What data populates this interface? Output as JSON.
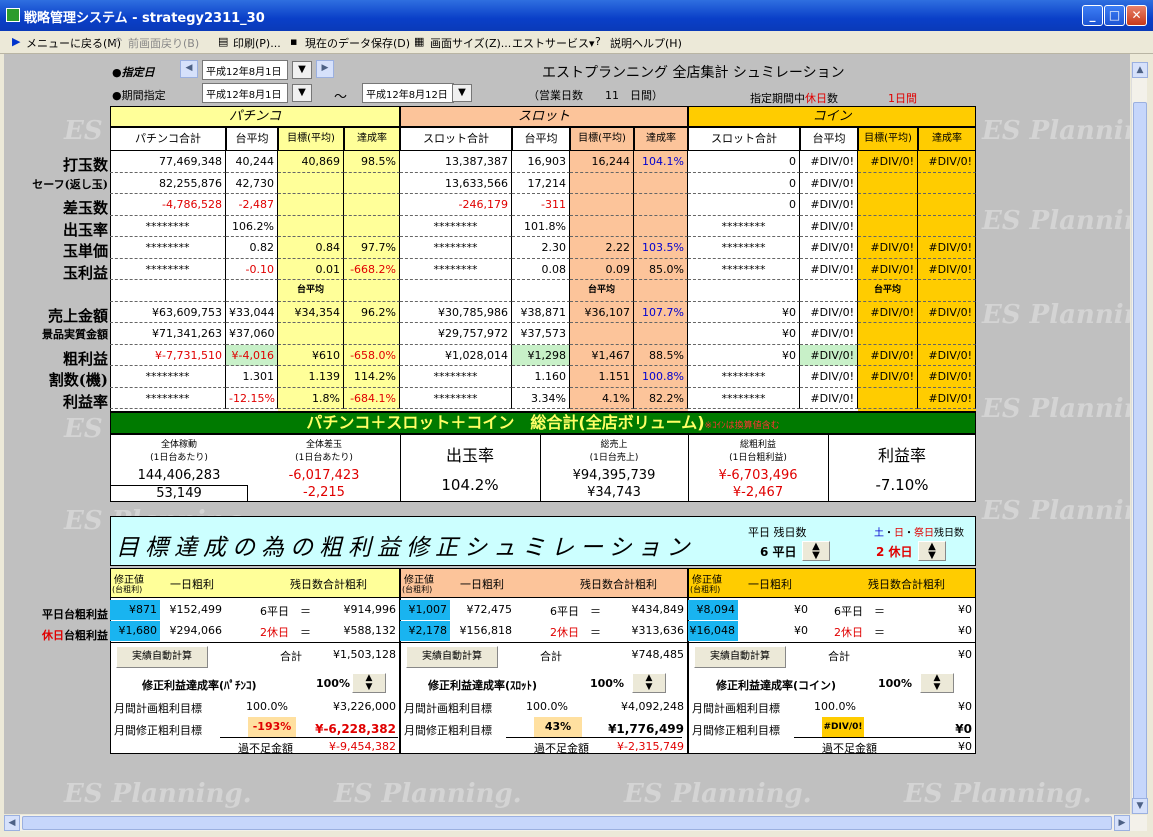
{
  "window": {
    "title": "戦略管理システム - strategy2311_30"
  },
  "menu": [
    "メニューに戻る(M)",
    "前画面戻り(B)",
    "印刷(P)...",
    "現在のデータ保存(D)",
    "画面サイズ(Z)...",
    "エストサービス▾",
    "説明ヘルプ(H)"
  ],
  "header": {
    "designated_label": "●指定日",
    "designated_date": "平成12年8月1日",
    "period_label": "●期間指定",
    "period_start": "平成12年8月1日",
    "tilde": "～",
    "period_end": "平成12年8月12日",
    "company_title": "エストプランニング 全店集計 シュミレーション",
    "business_days": "（営業日数　　11　日間）",
    "holiday_prefix": "指定期間中",
    "holiday_word": "休日",
    "holiday_suffix": "数",
    "holiday_days": "1日間"
  },
  "sections": {
    "pachinko": "パチンコ",
    "slot": "スロット",
    "coin": "コイン"
  },
  "col_headers": {
    "pachinko": [
      "パチンコ合計",
      "台平均",
      "目標(平均)",
      "達成率"
    ],
    "slot": [
      "スロット合計",
      "台平均",
      "目標(平均)",
      "達成率"
    ],
    "coin": [
      "スロット合計",
      "台平均",
      "目標(平均)",
      "達成率"
    ]
  },
  "row_labels": [
    "打玉数",
    "セーフ(返し玉)",
    "差玉数",
    "出玉率",
    "玉単価",
    "玉利益",
    "",
    "売上金額",
    "景品実質金額",
    "粗利益",
    "割数(機)",
    "利益率"
  ],
  "rows": [
    [
      "77,469,348",
      "40,244",
      "40,869",
      "98.5%",
      "13,387,387",
      "16,903",
      "16,244",
      "104.1%",
      "0",
      "#DIV/0!",
      "#DIV/0!",
      "#DIV/0!"
    ],
    [
      "82,255,876",
      "42,730",
      "",
      "",
      "13,633,566",
      "17,214",
      "",
      "",
      "0",
      "#DIV/0!",
      "",
      ""
    ],
    [
      "-4,786,528",
      "-2,487",
      "",
      "",
      "-246,179",
      "-311",
      "",
      "",
      "0",
      "#DIV/0!",
      "",
      ""
    ],
    [
      "********",
      "106.2%",
      "",
      "",
      "********",
      "101.8%",
      "",
      "",
      "********",
      "#DIV/0!",
      "",
      ""
    ],
    [
      "********",
      "0.82",
      "0.84",
      "97.7%",
      "********",
      "2.30",
      "2.22",
      "103.5%",
      "********",
      "#DIV/0!",
      "#DIV/0!",
      "#DIV/0!"
    ],
    [
      "********",
      "-0.10",
      "0.01",
      "-668.2%",
      "********",
      "0.08",
      "0.09",
      "85.0%",
      "********",
      "#DIV/0!",
      "#DIV/0!",
      "#DIV/0!"
    ],
    [
      "",
      "",
      "台平均",
      "",
      "",
      "",
      "台平均",
      "",
      "",
      "",
      "台平均",
      ""
    ],
    [
      "¥63,609,753",
      "¥33,044",
      "¥34,354",
      "96.2%",
      "¥30,785,986",
      "¥38,871",
      "¥36,107",
      "107.7%",
      "¥0",
      "#DIV/0!",
      "#DIV/0!",
      "#DIV/0!"
    ],
    [
      "¥71,341,263",
      "¥37,060",
      "",
      "",
      "¥29,757,972",
      "¥37,573",
      "",
      "",
      "¥0",
      "#DIV/0!",
      "",
      ""
    ],
    [
      "¥-7,731,510",
      "¥-4,016",
      "¥610",
      "-658.0%",
      "¥1,028,014",
      "¥1,298",
      "¥1,467",
      "88.5%",
      "¥0",
      "#DIV/0!",
      "#DIV/0!",
      "#DIV/0!"
    ],
    [
      "********",
      "1.301",
      "1.139",
      "114.2%",
      "********",
      "1.160",
      "1.151",
      "100.8%",
      "********",
      "#DIV/0!",
      "#DIV/0!",
      "#DIV/0!"
    ],
    [
      "********",
      "-12.15%",
      "1.8%",
      "-684.1%",
      "********",
      "3.34%",
      "4.1%",
      "82.2%",
      "********",
      "#DIV/0!",
      "",
      "#DIV/0!"
    ]
  ],
  "total": {
    "banner": "パチンコ＋スロット＋コイン　総合計(全店ボリューム)",
    "banner_note": "※ｺｲﾝは換算値含む",
    "c1_label": "全体稼動",
    "c1_sub": "(1日台あたり)",
    "c1_v1": "144,406,283",
    "c1_v2": "53,149",
    "c2_label": "全体差玉",
    "c2_sub": "(1日台あたり)",
    "c2_v1": "-6,017,423",
    "c2_v2": "-2,215",
    "c3_label": "出玉率",
    "c3_v": "104.2%",
    "c4_label": "総売上",
    "c4_sub": "(1日台売上)",
    "c4_v1": "¥94,395,739",
    "c4_v2": "¥34,743",
    "c5_label": "総粗利益",
    "c5_sub": "(1日台粗利益)",
    "c5_v1": "¥-6,703,496",
    "c5_v2": "¥-2,467",
    "c6_label": "利益率",
    "c6_v": "-7.10%"
  },
  "sim": {
    "title": "目標達成の為の粗利益修正シュミレーション",
    "weekday_label": "平日 残日数",
    "weekday_val": "6 平日",
    "holiday_label": "土・日・祭日残日数",
    "holiday_val": "2 休日",
    "hol_sat": "土",
    "hol_dot1": "・",
    "hol_sun": "日",
    "hol_dot2": "・",
    "hol_fes": "祭日",
    "hol_rest": "残日数",
    "hdr_fix": "修正値",
    "hdr_fix_sub": "(台粗利)",
    "hdr_daily": "一日粗利",
    "hdr_total": "残日数合計粗利",
    "left_labels": [
      "平日台粗利益",
      "休日台粗利益"
    ],
    "left_hol_red": "休日",
    "left_hol_rest": "台粗利益",
    "auto_btn": "実績自動計算",
    "sum_label": "合計",
    "p": {
      "fix1": "¥871",
      "fix2": "¥1,680",
      "daily1": "¥152,499",
      "daily2": "¥294,066",
      "d1": "6平日",
      "d2": "2休日",
      "eq": "＝",
      "tot1": "¥914,996",
      "tot2": "¥588,132",
      "sum": "¥1,503,128",
      "rate_label": "修正利益達成率(ﾊﾟﾁﾝｺ)",
      "rate": "100%",
      "plan_label": "月間計画粗利目標",
      "plan_pct": "100.0%",
      "plan_val": "¥3,226,000",
      "fixgoal_label": "月間修正粗利目標",
      "fix_pct": "-193%",
      "fix_val": "¥-6,228,382",
      "short_label": "過不足金額",
      "short_val": "¥-9,454,382"
    },
    "s": {
      "fix1": "¥1,007",
      "fix2": "¥2,178",
      "daily1": "¥72,475",
      "daily2": "¥156,818",
      "d1": "6平日",
      "d2": "2休日",
      "eq": "＝",
      "tot1": "¥434,849",
      "tot2": "¥313,636",
      "sum": "¥748,485",
      "rate_label": "修正利益達成率(ｽﾛｯﾄ)",
      "rate": "100%",
      "plan_label": "月間計画粗利目標",
      "plan_pct": "100.0%",
      "plan_val": "¥4,092,248",
      "fixgoal_label": "月間修正粗利目標",
      "fix_pct": "43%",
      "fix_val": "¥1,776,499",
      "short_label": "過不足金額",
      "short_val": "¥-2,315,749"
    },
    "c": {
      "fix1": "¥8,094",
      "fix2": "¥16,048",
      "daily1": "¥0",
      "daily2": "¥0",
      "d1": "6平日",
      "d2": "2休日",
      "eq": "＝",
      "tot1": "¥0",
      "tot2": "¥0",
      "sum": "¥0",
      "rate_label": "修正利益達成率(コイン)",
      "rate": "100%",
      "plan_label": "月間計画粗利目標",
      "plan_pct": "100.0%",
      "plan_val": "¥0",
      "fixgoal_label": "月間修正粗利目標",
      "fix_pct": "#DIV/0!",
      "fix_val": "¥0",
      "short_label": "過不足金額",
      "short_val": "¥0"
    }
  },
  "watermark": "ES Planning."
}
